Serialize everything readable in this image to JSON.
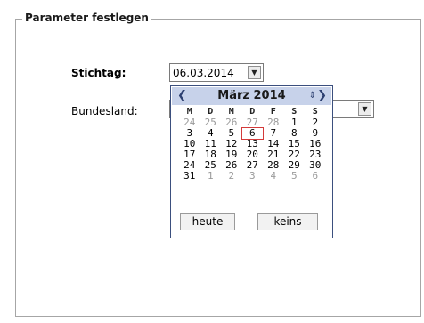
{
  "panel": {
    "title": "Parameter festlegen"
  },
  "form": {
    "stichtag_label": "Stichtag:",
    "stichtag_value": "06.03.2014",
    "bundesland_label": "Bundesland:"
  },
  "calendar": {
    "title": "März 2014",
    "weekdays": [
      "M",
      "D",
      "M",
      "D",
      "F",
      "S",
      "S"
    ],
    "weeks": [
      [
        "24",
        "25",
        "26",
        "27",
        "28",
        "1",
        "2"
      ],
      [
        "3",
        "4",
        "5",
        "6",
        "7",
        "8",
        "9"
      ],
      [
        "10",
        "11",
        "12",
        "13",
        "14",
        "15",
        "16"
      ],
      [
        "17",
        "18",
        "19",
        "20",
        "21",
        "22",
        "23"
      ],
      [
        "24",
        "25",
        "26",
        "27",
        "28",
        "29",
        "30"
      ],
      [
        "31",
        "1",
        "2",
        "3",
        "4",
        "5",
        "6"
      ]
    ],
    "today_button": "heute",
    "clear_button": "keins"
  }
}
